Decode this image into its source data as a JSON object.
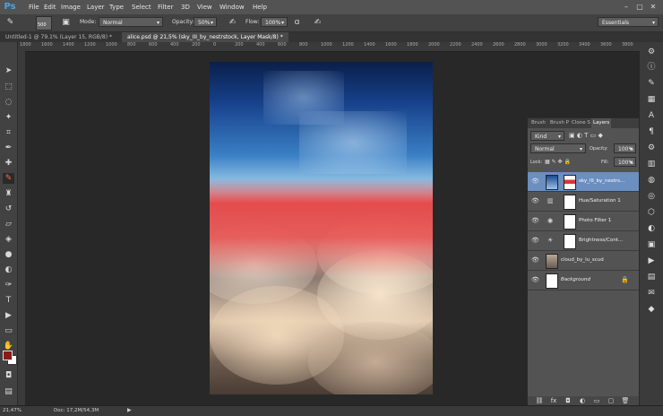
{
  "app": {
    "logo": "Ps"
  },
  "menu": [
    "File",
    "Edit",
    "Image",
    "Layer",
    "Type",
    "Select",
    "Filter",
    "3D",
    "View",
    "Window",
    "Help"
  ],
  "window_controls": [
    "–",
    "▢",
    "✕"
  ],
  "options": {
    "brush_size": "500",
    "mode_label": "Mode:",
    "mode_value": "Normal",
    "opacity_label": "Opacity:",
    "opacity_value": "50%",
    "flow_label": "Flow:",
    "flow_value": "100%",
    "workspace": "Essentials"
  },
  "tabs": [
    {
      "label": "Untitled-1 @ 79.1% (Layer 15, RGB/8) *",
      "active": false
    },
    {
      "label": "alice.psd @ 21,5% (sky_III_by_nestrstock, Layer Mask/8) *",
      "active": true
    }
  ],
  "ruler_numbers": [
    "1800",
    "1600",
    "1400",
    "1200",
    "1000",
    "800",
    "600",
    "400",
    "200",
    "0",
    "200",
    "400",
    "600",
    "800",
    "1000",
    "1200",
    "1400",
    "1600",
    "1800",
    "2000",
    "2200",
    "2400",
    "2600",
    "2800",
    "3000",
    "3200",
    "3400",
    "3600",
    "3800"
  ],
  "layers_panel": {
    "tabs": [
      "Brush",
      "Brush P",
      "Clone S",
      "Layers"
    ],
    "kind": "Kind",
    "blend_mode": "Normal",
    "opacity_label": "Opacity:",
    "opacity_value": "100%",
    "lock_label": "Lock:",
    "fill_label": "Fill:",
    "fill_value": "100%",
    "layers": [
      {
        "name": "sky_III_by_nestrs...",
        "selected": true
      },
      {
        "name": "Hue/Saturation 1",
        "selected": false
      },
      {
        "name": "Photo Filter 1",
        "selected": false
      },
      {
        "name": "Brightness/Cont...",
        "selected": false
      },
      {
        "name": "cloud_by_lu_scud",
        "selected": false
      },
      {
        "name": "Background",
        "selected": false
      }
    ],
    "bottom_icons": [
      "link-icon",
      "fx-icon",
      "mask-icon",
      "adjustment-icon",
      "folder-icon",
      "new-layer-icon",
      "trash-icon"
    ]
  },
  "status": {
    "zoom": "21,47%",
    "doc": "Doc: 17,2M/54,3M"
  },
  "colors": {
    "foreground": "#8b1a1a",
    "background": "#ffffff",
    "mask_overlay": "#e33a3a",
    "selected_layer": "#6b8fbf"
  }
}
